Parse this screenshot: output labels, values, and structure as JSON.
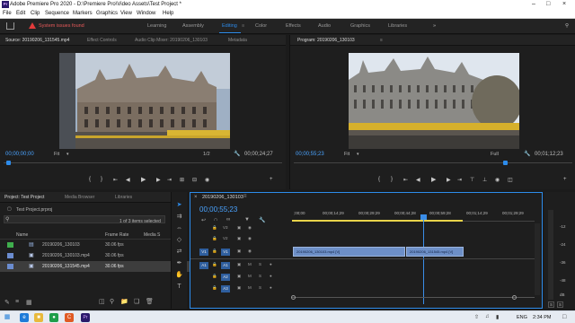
{
  "window": {
    "title": "Adobe Premiere Pro 2020 - D:\\Premiere Pro\\Video Assets\\Test Project *"
  },
  "menu": [
    "File",
    "Edit",
    "Clip",
    "Sequence",
    "Markers",
    "Graphics",
    "View",
    "Window",
    "Help"
  ],
  "workspace": {
    "warning": "System issues found",
    "tabs": [
      "Learning",
      "Assembly",
      "Editing",
      "Color",
      "Effects",
      "Audio",
      "Graphics",
      "Libraries"
    ],
    "active": "Editing"
  },
  "source_monitor": {
    "tabs": [
      "Source: 20190206_131545.mp4",
      "Effect Controls",
      "Audio Clip Mixer: 20190206_130103",
      "Metadata"
    ],
    "timecode_in": "00;00;00;00",
    "fit": "Fit",
    "resolution": "1/2",
    "duration": "00;00;24;27"
  },
  "program_monitor": {
    "tab": "Program: 20190206_130103",
    "timecode": "00;00;55;23",
    "fit": "Fit",
    "resolution": "Full",
    "duration": "00;01;12;23"
  },
  "project": {
    "tabs": [
      "Project: Test Project",
      "Media Browser",
      "Libraries"
    ],
    "file": "Test Project.prproj",
    "search_placeholder": "",
    "selection": "1 of 3 items selected",
    "columns": [
      "Name",
      "Frame Rate",
      "Media S"
    ],
    "items": [
      {
        "name": "20190206_130103",
        "frame_rate": "30.06 fps",
        "color": "#3fae4d",
        "type": "sequence"
      },
      {
        "name": "20190206_130103.mp4",
        "frame_rate": "30.06 fps",
        "color": "#6b8ccf",
        "type": "clip"
      },
      {
        "name": "20190206_131545.mp4",
        "frame_rate": "30.06 fps",
        "color": "#6b8ccf",
        "type": "clip"
      }
    ]
  },
  "timeline": {
    "tab": "20190206_130103",
    "timecode": "00;00;55;23",
    "ruler": [
      ";00;00",
      "00;00;14;29",
      "00;00;29;29",
      "00;00;44;28",
      "00;00;59;28",
      "00;01;14;29",
      "00;01;29;29"
    ],
    "video_tracks": [
      "V3",
      "V2",
      "V1"
    ],
    "audio_tracks": [
      "A1",
      "A2",
      "A3"
    ],
    "source_patch": [
      "V1",
      "A1"
    ],
    "clips": [
      {
        "name": "20190206_130103.mp4 [V]",
        "track": "V1"
      },
      {
        "name": "20190206_131545.mp4 [V]",
        "track": "V1"
      }
    ],
    "meter_labels": [
      "-12",
      "-24",
      "-36",
      "-48",
      "dB"
    ],
    "meter_solo": [
      "S",
      "S"
    ]
  },
  "taskbar": {
    "lang": "ENG",
    "time": "2:34 PM"
  },
  "colors": {
    "accent": "#2d8ceb",
    "warning": "#e23b3b",
    "clip": "#6d8fc7"
  }
}
